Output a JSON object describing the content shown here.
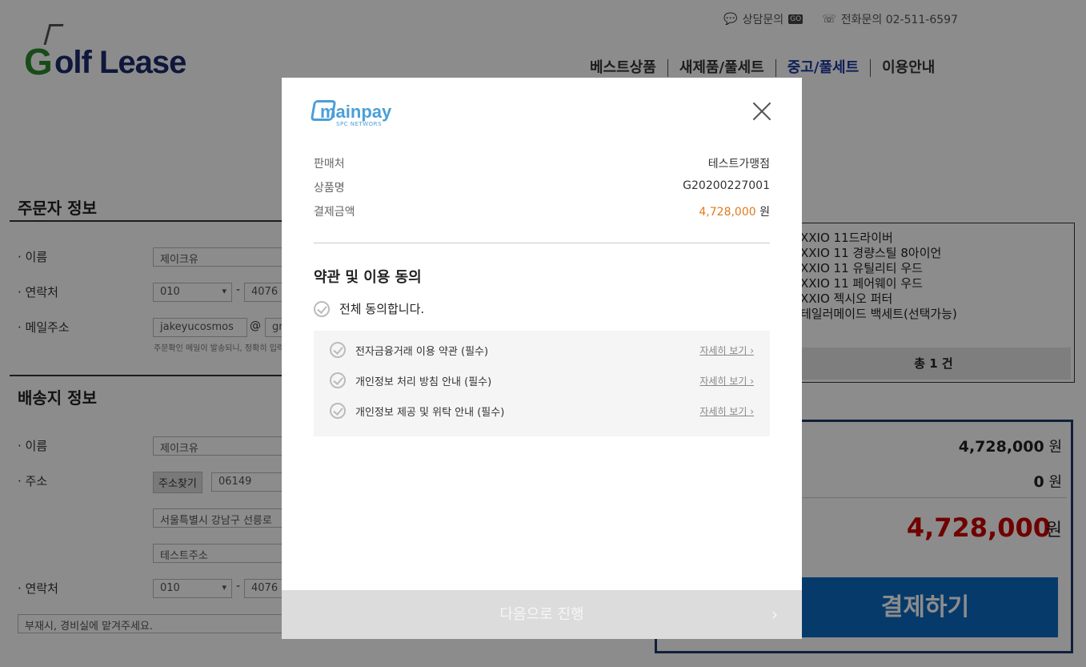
{
  "header": {
    "logo_text": "Golf Lease",
    "consult_label": "상담문의",
    "consult_badge": "GO",
    "phone_label": "전화문의 02-511-6597",
    "nav": [
      "베스트상품",
      "새제품/풀세트",
      "중고/풀세트",
      "이용안내"
    ],
    "nav_active_index": 2
  },
  "orderer": {
    "title": "주문자 정보",
    "name_label": "· 이름",
    "name_value": "제이크유",
    "phone_label": "· 연락처",
    "phone_prefix": "010",
    "phone_mid": "4076",
    "email_label": "· 메일주소",
    "email_id": "jakeyucosmos",
    "email_at": "@",
    "email_domain": "gm",
    "email_note": "주문확인 메일이 발송되니, 정확히 입력"
  },
  "shipping": {
    "title": "배송지 정보",
    "name_label": "· 이름",
    "name_value": "제이크유",
    "address_label": "· 주소",
    "find_address_button": "주소찾기",
    "zipcode": "06149",
    "address1": "서울특별시 강남구 선릉로",
    "address2": "테스트주소",
    "phone_label": "· 연락처",
    "phone_prefix": "010",
    "phone_mid": "4076",
    "memo": "부재시, 경비실에 맡겨주세요."
  },
  "cart": {
    "items": [
      "XXIO 11드라이버",
      "XXIO 11 경량스틸 8아이언",
      "XXIO 11 유틸리티 우드",
      "XXIO 11 페어웨이 우드",
      "XXIO 젝시오 퍼터",
      "테일러메이드 백세트(선택가능)"
    ],
    "total_count": "총 1 건"
  },
  "payment_summary": {
    "product_amount": "4,728,000",
    "discount_amount": "0",
    "won": "원",
    "final_amount": "4,728,000",
    "pay_button": "결제하기"
  },
  "modal": {
    "brand": "mainpay",
    "brand_sub": "SPC NETWORS",
    "seller_label": "판매처",
    "seller_value": "테스트가맹점",
    "product_label": "상품명",
    "product_value": "G20200227001",
    "amount_label": "결제금액",
    "amount_value": "4,728,000",
    "amount_unit": "원",
    "terms_title": "약관 및 이용 동의",
    "agree_all": "전체 동의합니다.",
    "terms": [
      {
        "label": "전자금융거래 이용 약관 (필수)",
        "detail": "자세히 보기"
      },
      {
        "label": "개인정보 처리 방침 안내 (필수)",
        "detail": "자세히 보기"
      },
      {
        "label": "개인정보 제공 및 위탁 안내 (필수)",
        "detail": "자세히 보기"
      }
    ],
    "next_button": "다음으로 진행",
    "next_arrow": "›"
  }
}
